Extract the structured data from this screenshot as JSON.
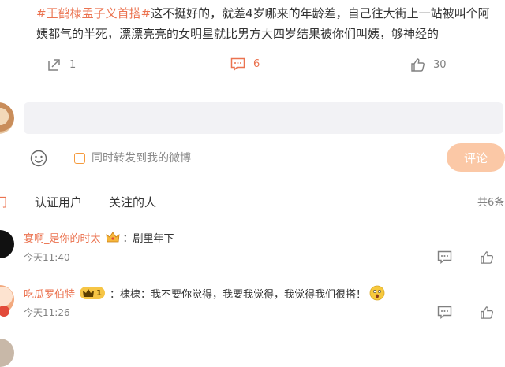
{
  "post": {
    "hashtag": "#王鹤棣孟子义首搭#",
    "text": "这不挺好的，就差4岁哪来的年龄差，自己往大街上一站被叫个阿姨都气的半死，漂漂亮亮的女明星就比男方大四岁结果被你们叫姨，够神经的",
    "repost_count": "1",
    "comment_count": "6",
    "like_count": "30"
  },
  "composer": {
    "repost_label": "同时转发到我的微博",
    "submit_label": "评论"
  },
  "tabs": [
    {
      "label": "门"
    },
    {
      "label": "认证用户"
    },
    {
      "label": "关注的人"
    }
  ],
  "total_count": "共6条",
  "comments": [
    {
      "username": "宴啊_是你的时太",
      "text": "：剧里年下",
      "time": "今天11:40"
    },
    {
      "username": "吃瓜罗伯特",
      "vip_level": "1",
      "text": "：棣棣：我不要你觉得，我要我觉得，我觉得我们很搭！",
      "time": "今天11:26"
    },
    {
      "username": "",
      "text": ""
    }
  ],
  "colors": {
    "accent": "#eb7350",
    "submit_disabled": "#fbc8a6",
    "input_bg": "#f2f2f5"
  }
}
